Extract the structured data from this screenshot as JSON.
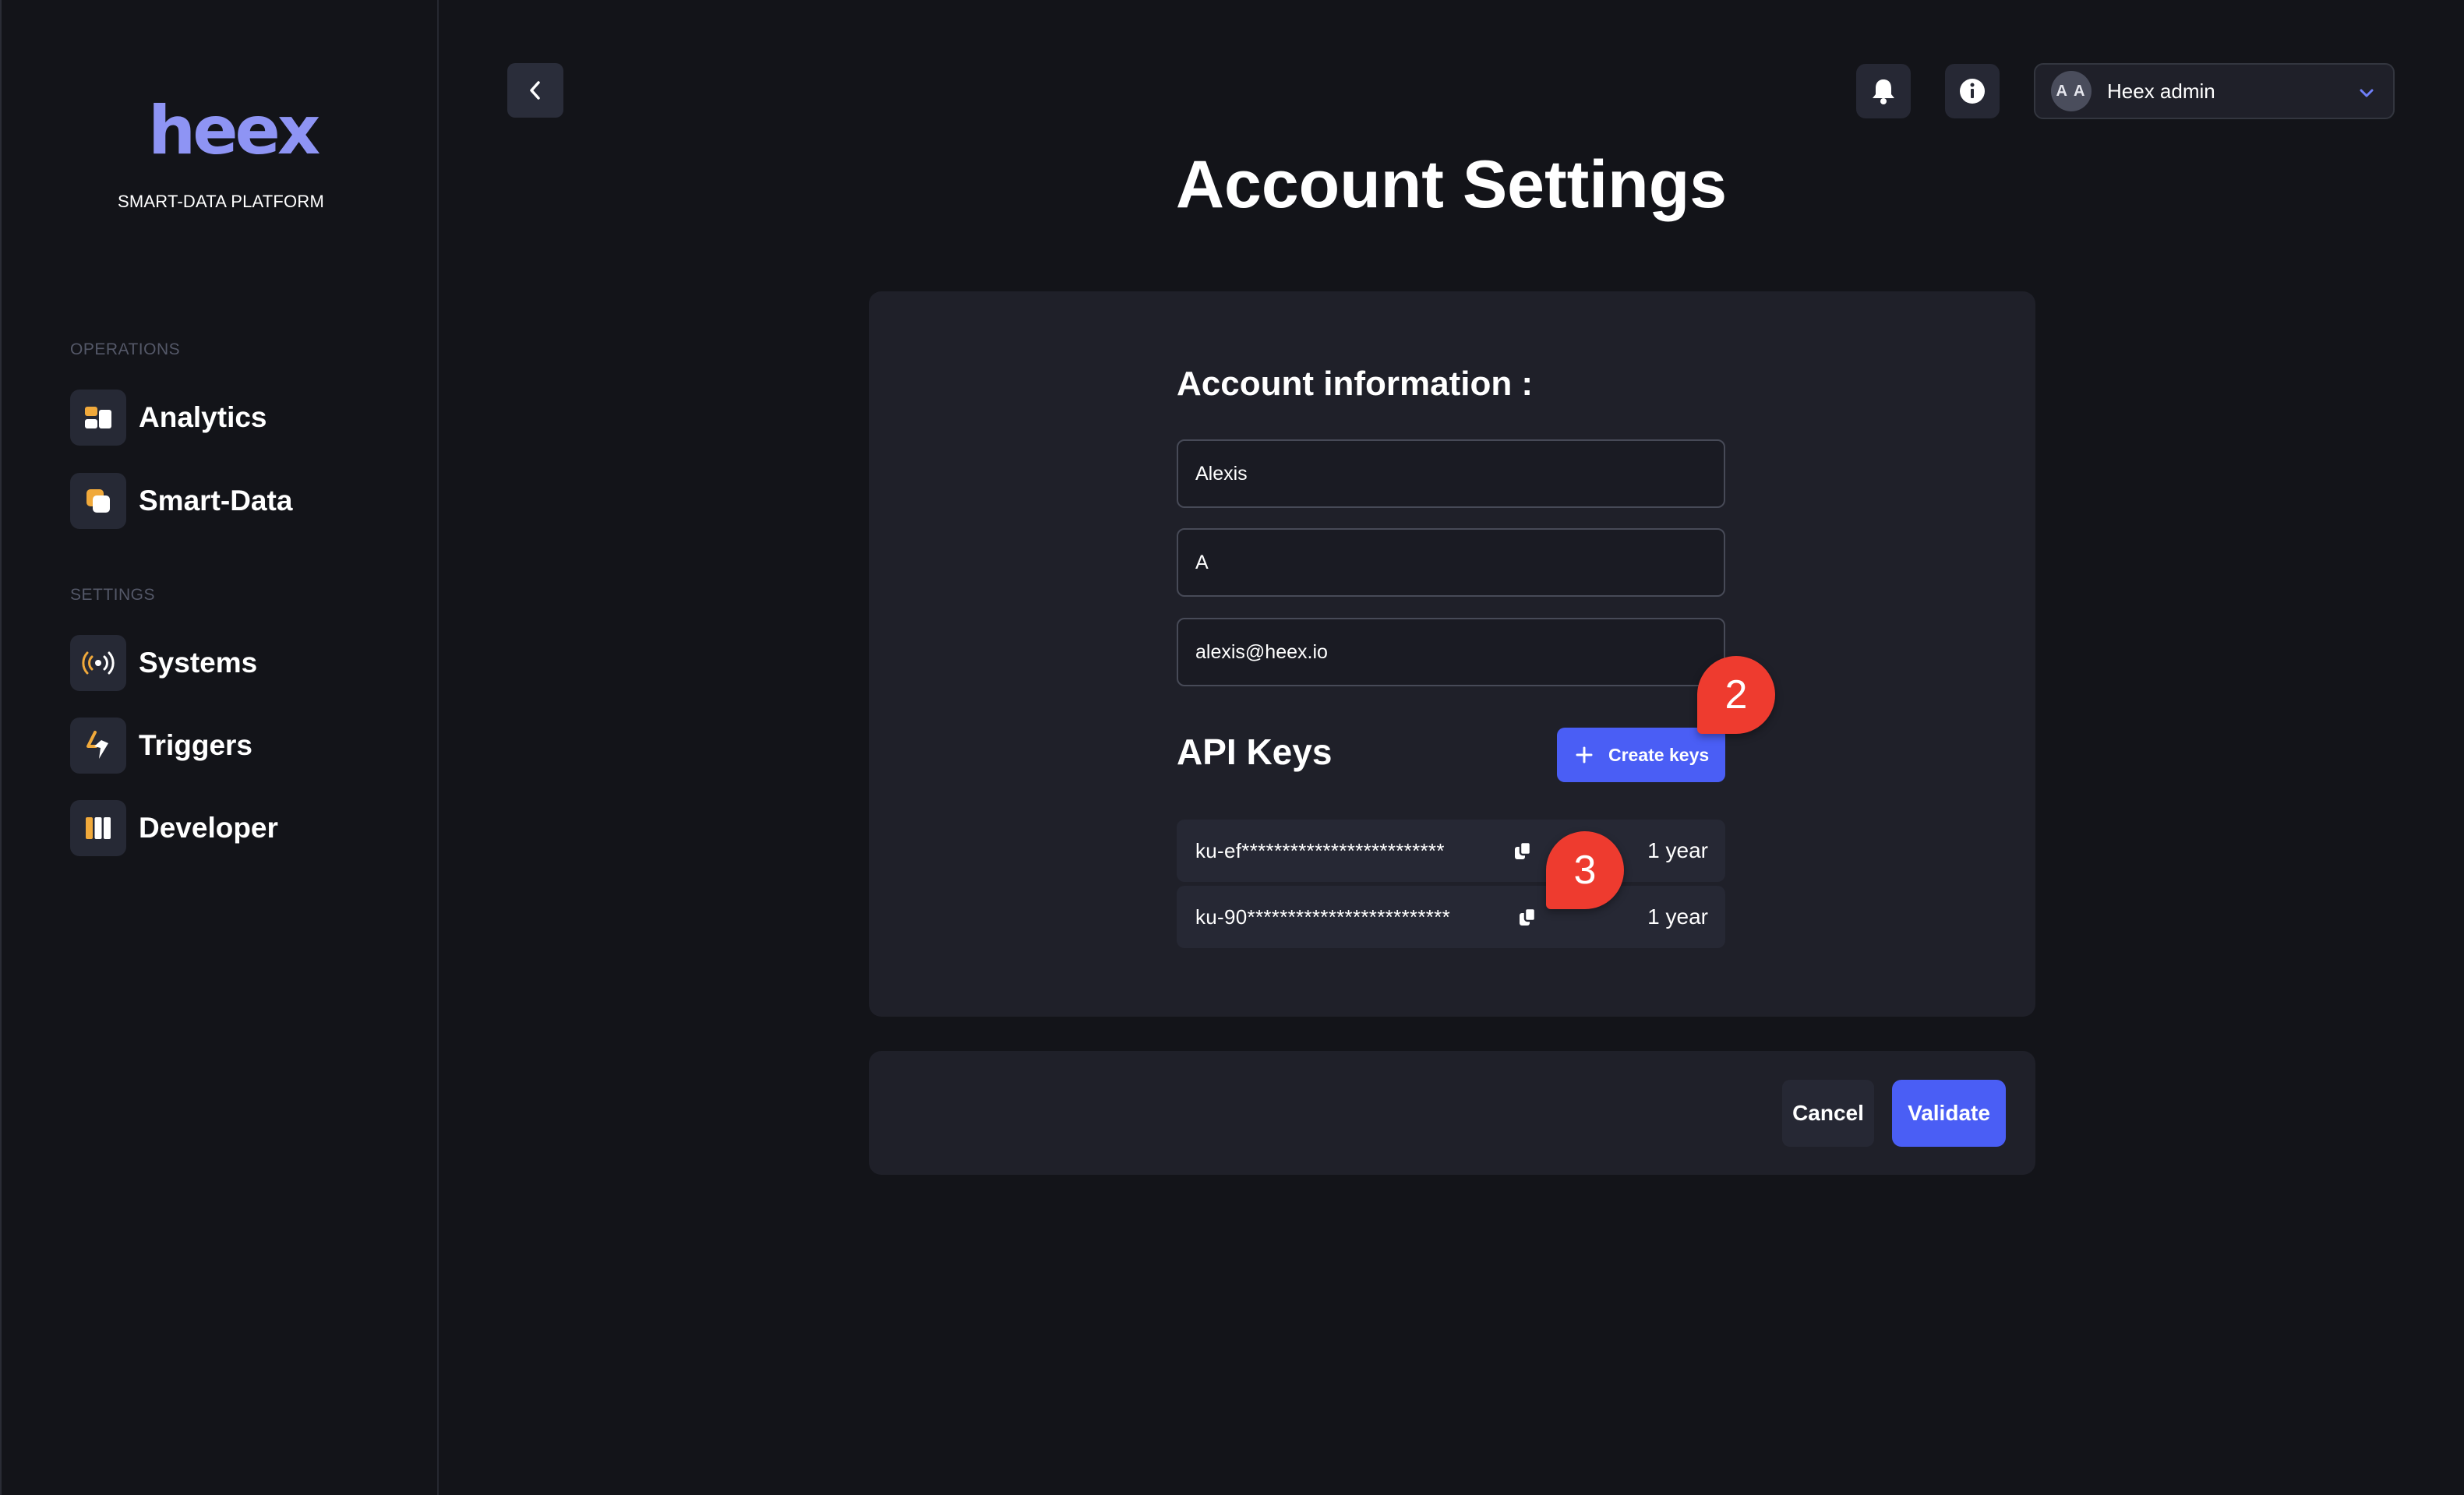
{
  "brand": {
    "logo_text": "heex",
    "tagline": "SMART-DATA PLATFORM",
    "accent": "#8e94f4"
  },
  "sidebar": {
    "sections": [
      {
        "label": "OPERATIONS",
        "items": [
          {
            "label": "Analytics",
            "icon": "analytics-icon"
          },
          {
            "label": "Smart-Data",
            "icon": "smart-data-icon"
          }
        ]
      },
      {
        "label": "SETTINGS",
        "items": [
          {
            "label": "Systems",
            "icon": "systems-icon"
          },
          {
            "label": "Triggers",
            "icon": "triggers-icon"
          },
          {
            "label": "Developer",
            "icon": "developer-icon"
          }
        ]
      }
    ]
  },
  "header": {
    "back_icon": "chevron-left-icon",
    "notifications_icon": "bell-icon",
    "info_icon": "info-icon",
    "user": {
      "initials": "A A",
      "name": "Heex admin",
      "dropdown_icon": "chevron-down-icon"
    }
  },
  "page": {
    "title": "Account Settings"
  },
  "account": {
    "title": "Account information :",
    "first_name": "Alexis",
    "last_name": "A",
    "email": "alexis@heex.io"
  },
  "api_keys": {
    "title": "API Keys",
    "create_label": "Create keys",
    "keys": [
      {
        "value": "ku-ef*************************",
        "expiry": "1 year"
      },
      {
        "value": "ku-90*************************",
        "expiry": "1 year"
      }
    ]
  },
  "callouts": {
    "create": "2",
    "copy": "3",
    "color": "#ee3b2f"
  },
  "footer": {
    "cancel_label": "Cancel",
    "validate_label": "Validate"
  },
  "colors": {
    "background": "#131419",
    "card": "#1f2029",
    "primary": "#4a5ef5"
  }
}
